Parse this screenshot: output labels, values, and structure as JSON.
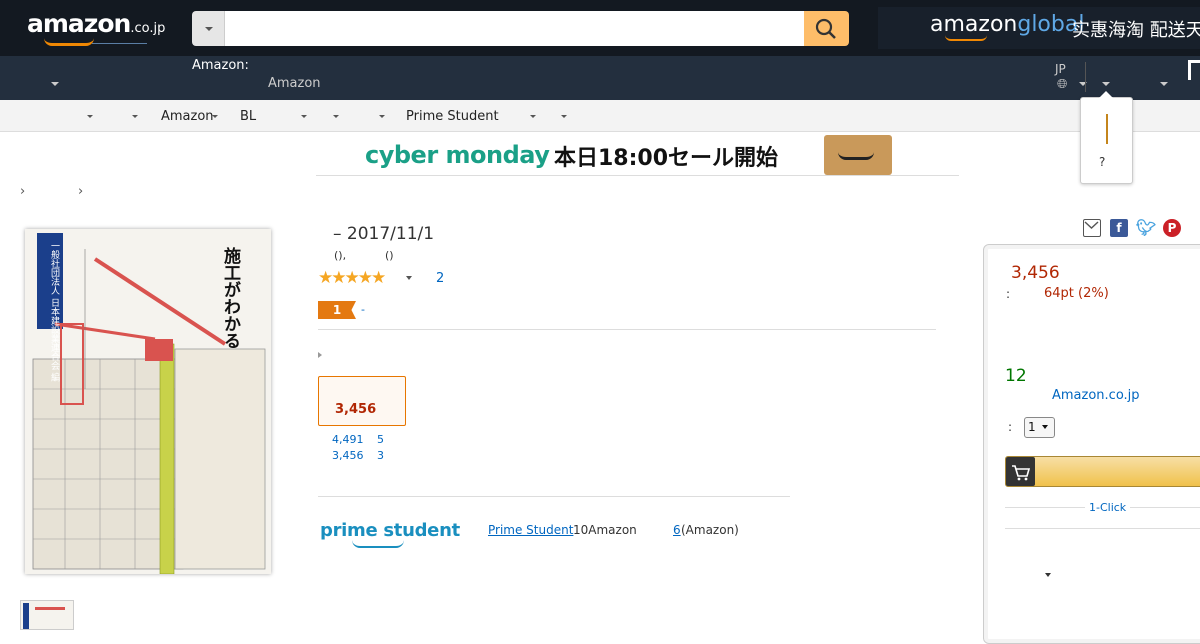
{
  "header": {
    "logo_text": "amazon",
    "logo_suffix": ".co.jp",
    "search": {
      "placeholder": "",
      "value": ""
    },
    "global_brand": "amazon",
    "global_word": "global",
    "global_cn": "实惠海淘 配送天",
    "deliver_label": "Amazon:",
    "deliver_value": "Amazon",
    "lang": "JP"
  },
  "subnav": {
    "items": [
      "Amazon",
      "BL",
      "Prime Student"
    ]
  },
  "popover": {
    "text": "?"
  },
  "banner": {
    "title": "cyber monday",
    "subtitle": "本日18:00セール開始"
  },
  "breadcrumb": [
    "›",
    "›"
  ],
  "book": {
    "cover_title": "施工がわかる イラスト建築生産入門",
    "cover_publisher": "一般社団法人 日本建設業連合会 編",
    "title": "– 2017/11/1",
    "byline_1": "(),",
    "byline_2": "()",
    "rating_count": "2",
    "bestseller_badge": "1",
    "bestseller_dash": "-"
  },
  "formats": {
    "price": "3,456",
    "used_offers": [
      {
        "price": "4,491",
        "count": "5"
      },
      {
        "price": "3,456",
        "count": "3"
      }
    ]
  },
  "prime_student": {
    "logo": "prime student",
    "link": "Prime Student",
    "text_1": "10Amazon",
    "link_2": "6",
    "text_2": "(Amazon)"
  },
  "buybox": {
    "price": "3,456",
    "points_label": ":",
    "points": "64pt (2%)",
    "stock": "12",
    "seller": "Amazon.co.jp",
    "qty_label": ":",
    "qty": "1",
    "one_click": "1-Click"
  },
  "colors": {
    "nav_dark": "#131921",
    "nav": "#232f3e",
    "accent": "#febd69",
    "price": "#b12704",
    "link": "#0066c0",
    "stock": "#007600"
  }
}
